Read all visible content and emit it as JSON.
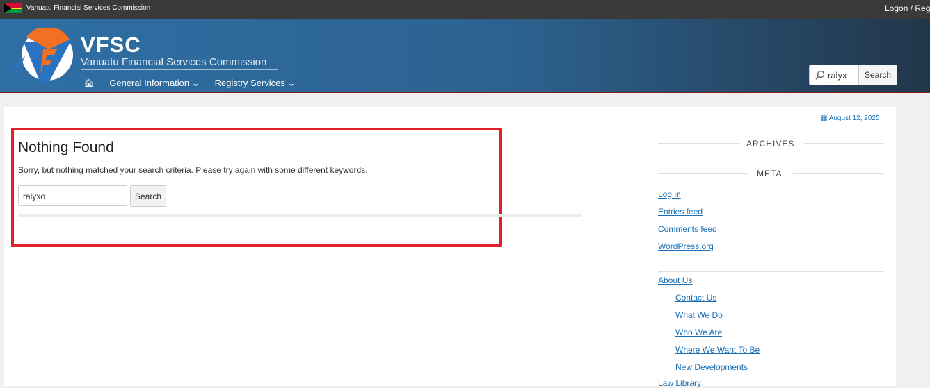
{
  "topbar": {
    "site_name": "Vanuatu Financial Services Commission",
    "logon": "Logon / Regi"
  },
  "header": {
    "short_name": "VFSC",
    "full_name": "Vanuatu Financial Services Commission",
    "nav": [
      {
        "label": "General Information",
        "dropdown": true
      },
      {
        "label": "Registry Services",
        "dropdown": true
      }
    ],
    "search": {
      "value": "ralyx",
      "button": "Search"
    }
  },
  "date": "August 12, 2025",
  "main": {
    "title": "Nothing Found",
    "message": "Sorry, but nothing matched your search criteria. Please try again with some different keywords.",
    "search_value": "ralyxo",
    "search_button": "Search"
  },
  "sidebar": {
    "archives_title": "ARCHIVES",
    "meta_title": "META",
    "meta_links": [
      "Log in",
      "Entries feed",
      "Comments feed",
      "WordPress.org"
    ],
    "about": {
      "label": "About Us",
      "children": [
        "Contact Us",
        "What We Do",
        "Who We Are",
        "Where We Want To Be",
        "New Developments"
      ]
    },
    "law_library": "Law Library"
  },
  "colors": {
    "accent_link": "#1a6fb5",
    "highlight_border": "#e0202a",
    "header_start": "#2f6fa6",
    "header_end": "#22364a"
  }
}
